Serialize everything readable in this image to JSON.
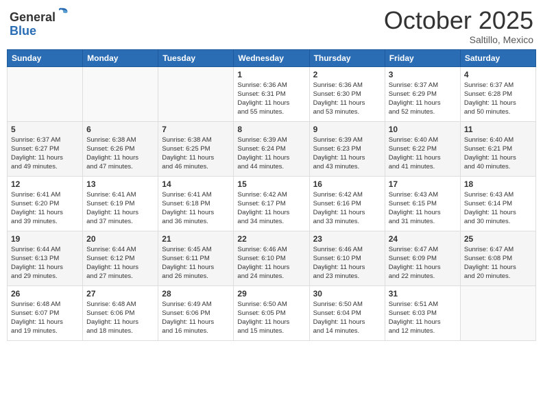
{
  "header": {
    "logo_general": "General",
    "logo_blue": "Blue",
    "month_title": "October 2025",
    "location": "Saltillo, Mexico"
  },
  "days_of_week": [
    "Sunday",
    "Monday",
    "Tuesday",
    "Wednesday",
    "Thursday",
    "Friday",
    "Saturday"
  ],
  "weeks": [
    [
      {
        "day": "",
        "info": ""
      },
      {
        "day": "",
        "info": ""
      },
      {
        "day": "",
        "info": ""
      },
      {
        "day": "1",
        "info": "Sunrise: 6:36 AM\nSunset: 6:31 PM\nDaylight: 11 hours\nand 55 minutes."
      },
      {
        "day": "2",
        "info": "Sunrise: 6:36 AM\nSunset: 6:30 PM\nDaylight: 11 hours\nand 53 minutes."
      },
      {
        "day": "3",
        "info": "Sunrise: 6:37 AM\nSunset: 6:29 PM\nDaylight: 11 hours\nand 52 minutes."
      },
      {
        "day": "4",
        "info": "Sunrise: 6:37 AM\nSunset: 6:28 PM\nDaylight: 11 hours\nand 50 minutes."
      }
    ],
    [
      {
        "day": "5",
        "info": "Sunrise: 6:37 AM\nSunset: 6:27 PM\nDaylight: 11 hours\nand 49 minutes."
      },
      {
        "day": "6",
        "info": "Sunrise: 6:38 AM\nSunset: 6:26 PM\nDaylight: 11 hours\nand 47 minutes."
      },
      {
        "day": "7",
        "info": "Sunrise: 6:38 AM\nSunset: 6:25 PM\nDaylight: 11 hours\nand 46 minutes."
      },
      {
        "day": "8",
        "info": "Sunrise: 6:39 AM\nSunset: 6:24 PM\nDaylight: 11 hours\nand 44 minutes."
      },
      {
        "day": "9",
        "info": "Sunrise: 6:39 AM\nSunset: 6:23 PM\nDaylight: 11 hours\nand 43 minutes."
      },
      {
        "day": "10",
        "info": "Sunrise: 6:40 AM\nSunset: 6:22 PM\nDaylight: 11 hours\nand 41 minutes."
      },
      {
        "day": "11",
        "info": "Sunrise: 6:40 AM\nSunset: 6:21 PM\nDaylight: 11 hours\nand 40 minutes."
      }
    ],
    [
      {
        "day": "12",
        "info": "Sunrise: 6:41 AM\nSunset: 6:20 PM\nDaylight: 11 hours\nand 39 minutes."
      },
      {
        "day": "13",
        "info": "Sunrise: 6:41 AM\nSunset: 6:19 PM\nDaylight: 11 hours\nand 37 minutes."
      },
      {
        "day": "14",
        "info": "Sunrise: 6:41 AM\nSunset: 6:18 PM\nDaylight: 11 hours\nand 36 minutes."
      },
      {
        "day": "15",
        "info": "Sunrise: 6:42 AM\nSunset: 6:17 PM\nDaylight: 11 hours\nand 34 minutes."
      },
      {
        "day": "16",
        "info": "Sunrise: 6:42 AM\nSunset: 6:16 PM\nDaylight: 11 hours\nand 33 minutes."
      },
      {
        "day": "17",
        "info": "Sunrise: 6:43 AM\nSunset: 6:15 PM\nDaylight: 11 hours\nand 31 minutes."
      },
      {
        "day": "18",
        "info": "Sunrise: 6:43 AM\nSunset: 6:14 PM\nDaylight: 11 hours\nand 30 minutes."
      }
    ],
    [
      {
        "day": "19",
        "info": "Sunrise: 6:44 AM\nSunset: 6:13 PM\nDaylight: 11 hours\nand 29 minutes."
      },
      {
        "day": "20",
        "info": "Sunrise: 6:44 AM\nSunset: 6:12 PM\nDaylight: 11 hours\nand 27 minutes."
      },
      {
        "day": "21",
        "info": "Sunrise: 6:45 AM\nSunset: 6:11 PM\nDaylight: 11 hours\nand 26 minutes."
      },
      {
        "day": "22",
        "info": "Sunrise: 6:46 AM\nSunset: 6:10 PM\nDaylight: 11 hours\nand 24 minutes."
      },
      {
        "day": "23",
        "info": "Sunrise: 6:46 AM\nSunset: 6:10 PM\nDaylight: 11 hours\nand 23 minutes."
      },
      {
        "day": "24",
        "info": "Sunrise: 6:47 AM\nSunset: 6:09 PM\nDaylight: 11 hours\nand 22 minutes."
      },
      {
        "day": "25",
        "info": "Sunrise: 6:47 AM\nSunset: 6:08 PM\nDaylight: 11 hours\nand 20 minutes."
      }
    ],
    [
      {
        "day": "26",
        "info": "Sunrise: 6:48 AM\nSunset: 6:07 PM\nDaylight: 11 hours\nand 19 minutes."
      },
      {
        "day": "27",
        "info": "Sunrise: 6:48 AM\nSunset: 6:06 PM\nDaylight: 11 hours\nand 18 minutes."
      },
      {
        "day": "28",
        "info": "Sunrise: 6:49 AM\nSunset: 6:06 PM\nDaylight: 11 hours\nand 16 minutes."
      },
      {
        "day": "29",
        "info": "Sunrise: 6:50 AM\nSunset: 6:05 PM\nDaylight: 11 hours\nand 15 minutes."
      },
      {
        "day": "30",
        "info": "Sunrise: 6:50 AM\nSunset: 6:04 PM\nDaylight: 11 hours\nand 14 minutes."
      },
      {
        "day": "31",
        "info": "Sunrise: 6:51 AM\nSunset: 6:03 PM\nDaylight: 11 hours\nand 12 minutes."
      },
      {
        "day": "",
        "info": ""
      }
    ]
  ]
}
